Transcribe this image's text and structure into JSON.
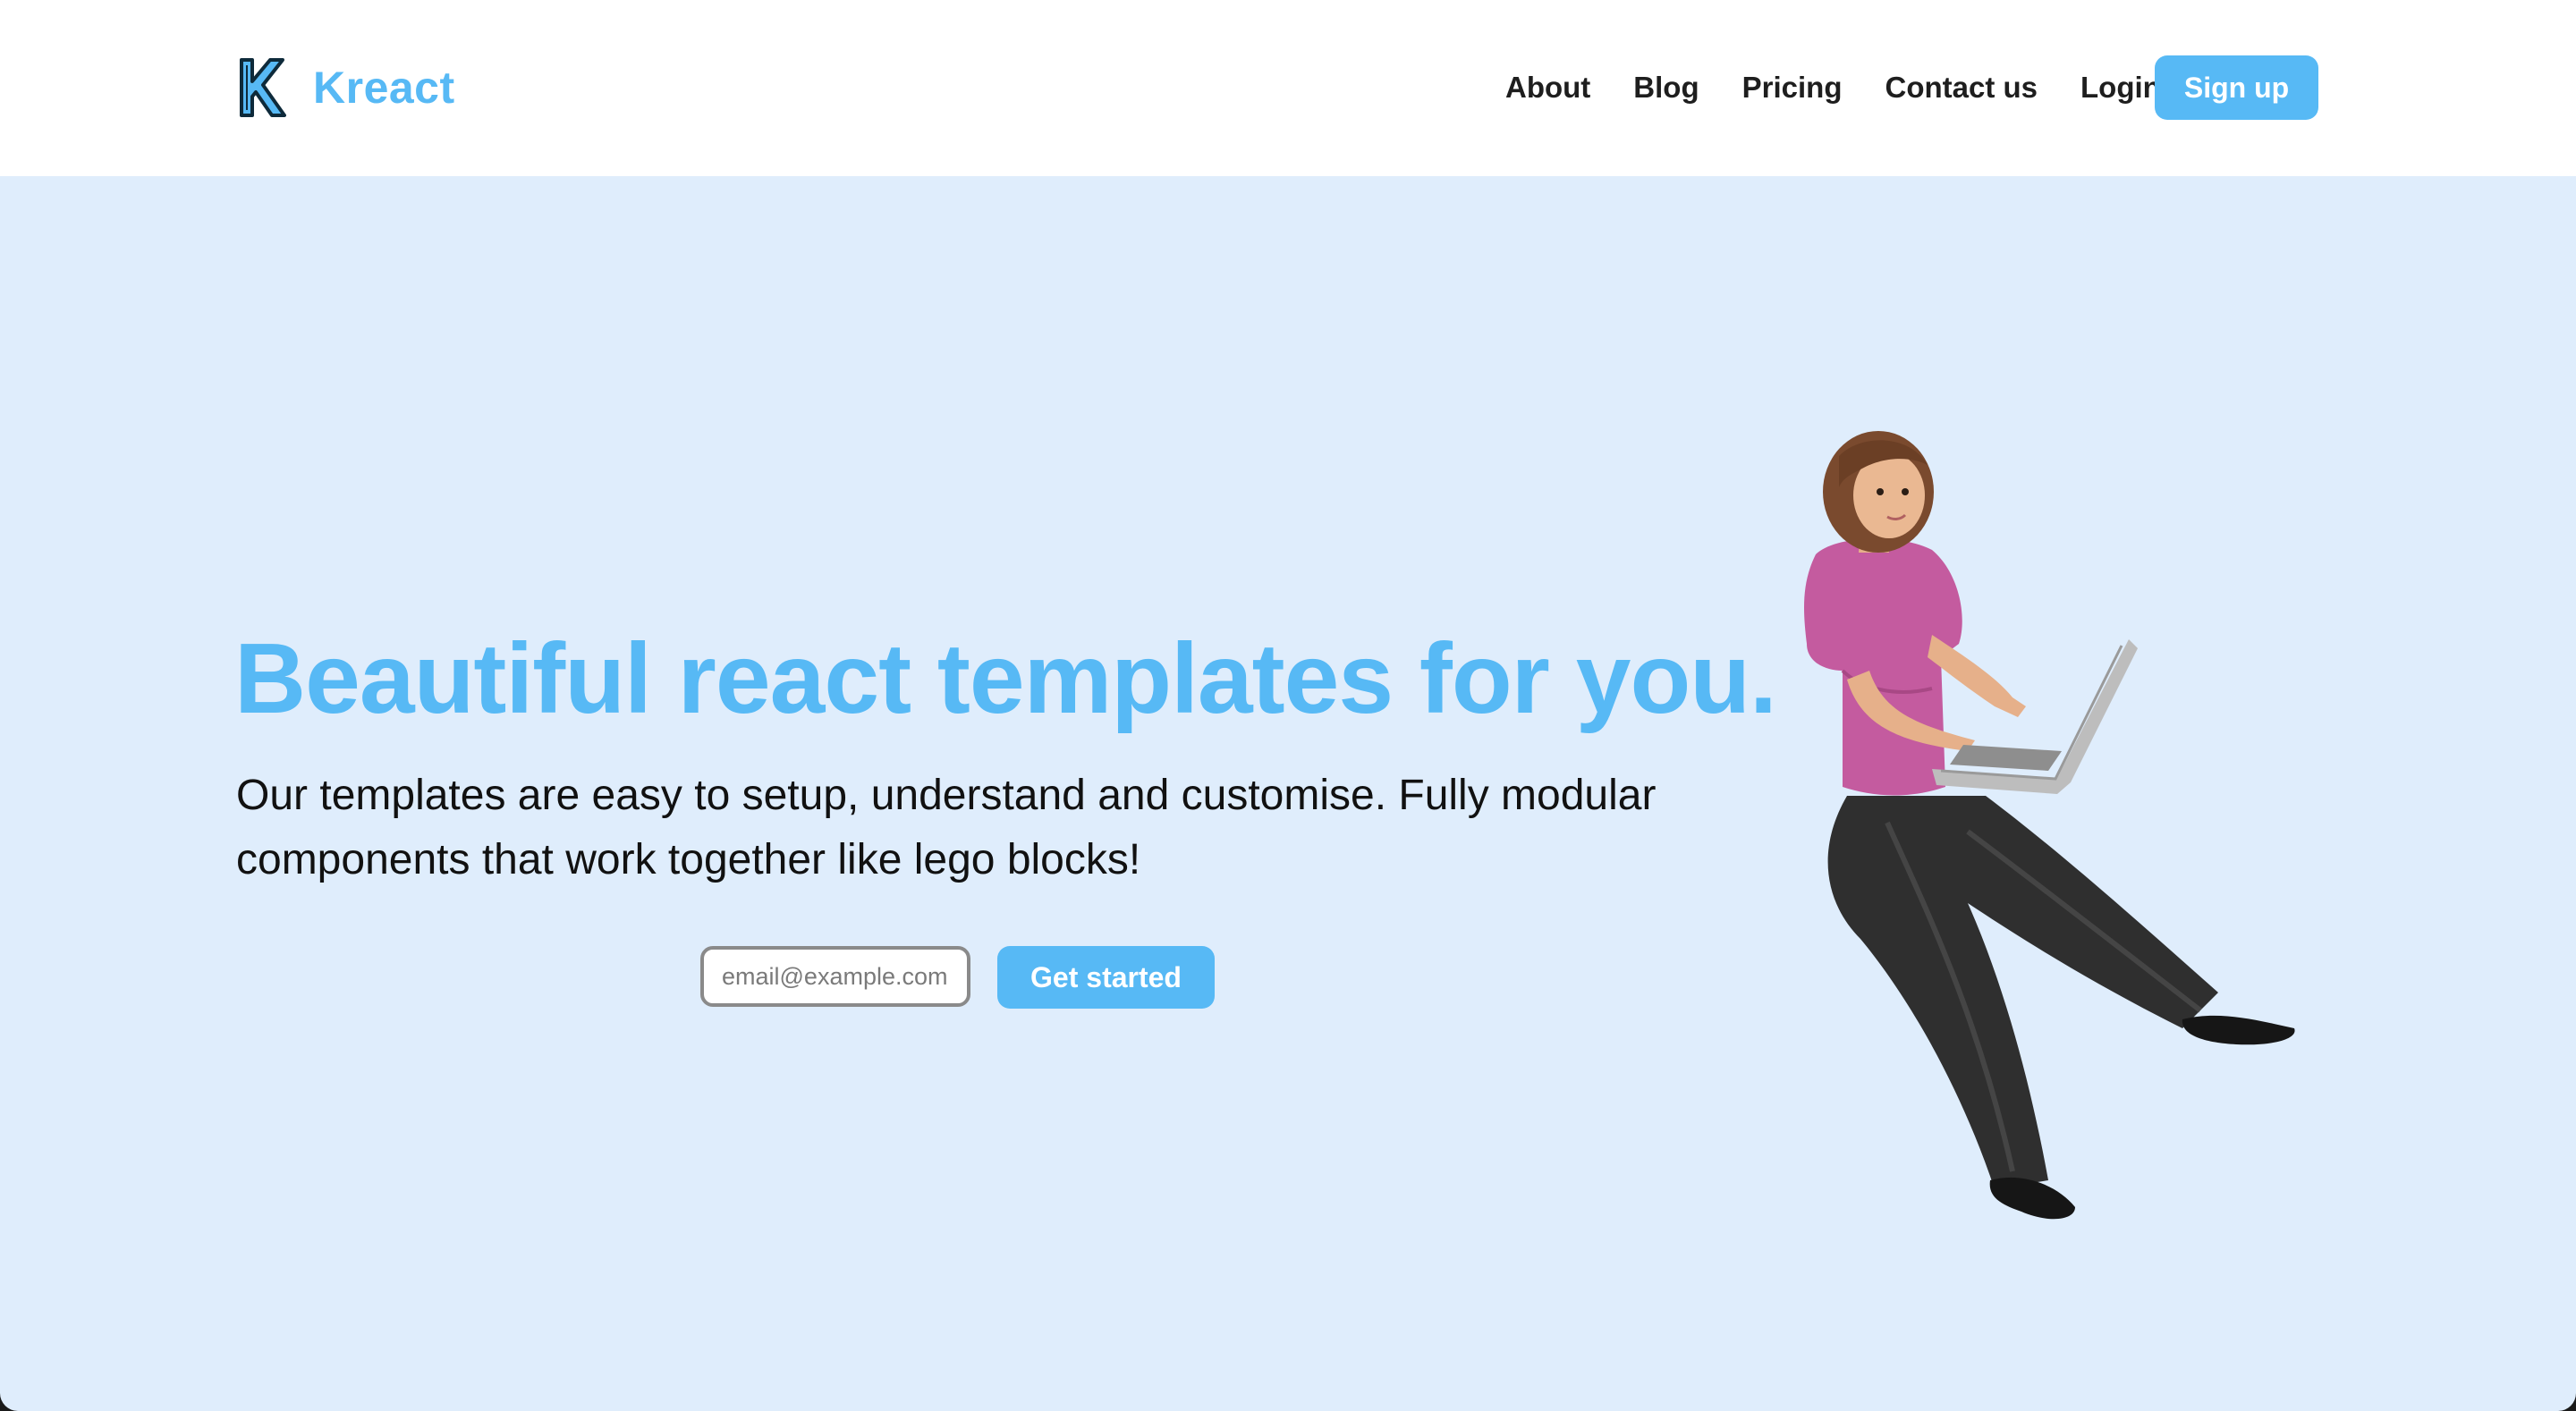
{
  "brand": {
    "name": "Kreact",
    "logo_letter": "K",
    "color": "#57b9f5"
  },
  "nav": {
    "links": [
      "About",
      "Blog",
      "Pricing",
      "Contact us",
      "Login"
    ],
    "signup_label": "Sign up"
  },
  "hero": {
    "title": "Beautiful react templates for you.",
    "description": "Our templates are easy to setup, understand and customise. Fully modular components that work together like lego blocks!",
    "email_placeholder": "email@example.com",
    "cta_label": "Get started"
  },
  "colors": {
    "accent": "#57b9f5",
    "hero_background": "#dfedfc",
    "nav_background": "#ffffff",
    "text": "#111111"
  }
}
